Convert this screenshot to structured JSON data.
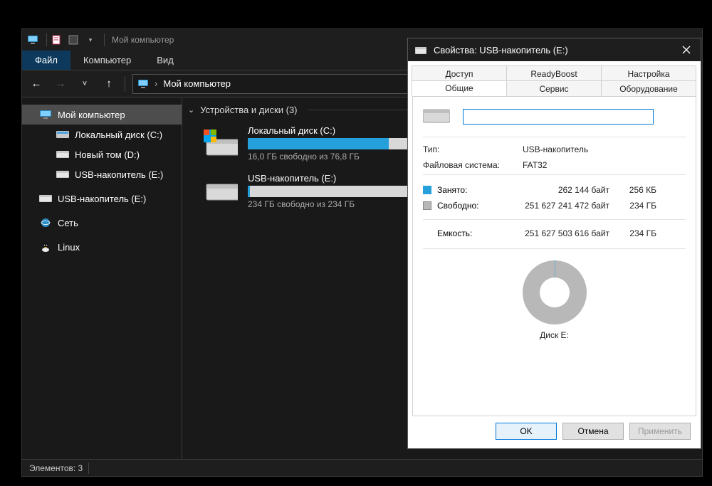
{
  "titlebar": {
    "title": "Мой компьютер"
  },
  "menubar": {
    "file": "Файл",
    "computer": "Компьютер",
    "view": "Вид"
  },
  "addressbar": {
    "location": "Мой компьютер"
  },
  "sidebar": {
    "my_computer": "Мой компьютер",
    "local_disk_c": "Локальный диск (C:)",
    "new_volume_d": "Новый том (D:)",
    "usb_e": "USB-накопитель (E:)",
    "usb_e_root": "USB-накопитель (E:)",
    "network": "Сеть",
    "linux": "Linux"
  },
  "main": {
    "group_header": "Устройства и диски (3)",
    "drive_c": {
      "name": "Локальный диск (C:)",
      "sub": "16,0 ГБ свободно из 76,8 ГБ",
      "fill_pct": 79
    },
    "drive_e": {
      "name": "USB-накопитель (E:)",
      "sub": "234 ГБ свободно из 234 ГБ",
      "fill_pct": 1
    }
  },
  "statusbar": {
    "count": "Элементов: 3"
  },
  "props": {
    "title": "Свойства: USB-накопитель (E:)",
    "tabs": {
      "access": "Доступ",
      "readyboost": "ReadyBoost",
      "settings": "Настройка",
      "general": "Общие",
      "service": "Сервис",
      "hardware": "Оборудование"
    },
    "name_value": "",
    "type_label": "Тип:",
    "type_value": "USB-накопитель",
    "fs_label": "Файловая система:",
    "fs_value": "FAT32",
    "used_label": "Занято:",
    "used_bytes": "262 144 байт",
    "used_hum": "256 КБ",
    "free_label": "Свободно:",
    "free_bytes": "251 627 241 472 байт",
    "free_hum": "234 ГБ",
    "cap_label": "Емкость:",
    "cap_bytes": "251 627 503 616 байт",
    "cap_hum": "234 ГБ",
    "disk_label": "Диск E:",
    "ok": "OK",
    "cancel": "Отмена",
    "apply": "Применить"
  },
  "chart_data": {
    "type": "pie",
    "title": "Диск E:",
    "series": [
      {
        "name": "Занято",
        "value": 262144,
        "human": "256 КБ",
        "color": "#26a0da"
      },
      {
        "name": "Свободно",
        "value": 251627241472,
        "human": "234 ГБ",
        "color": "#b8b8b8"
      }
    ],
    "capacity": {
      "bytes": 251627503616,
      "human": "234 ГБ"
    }
  }
}
